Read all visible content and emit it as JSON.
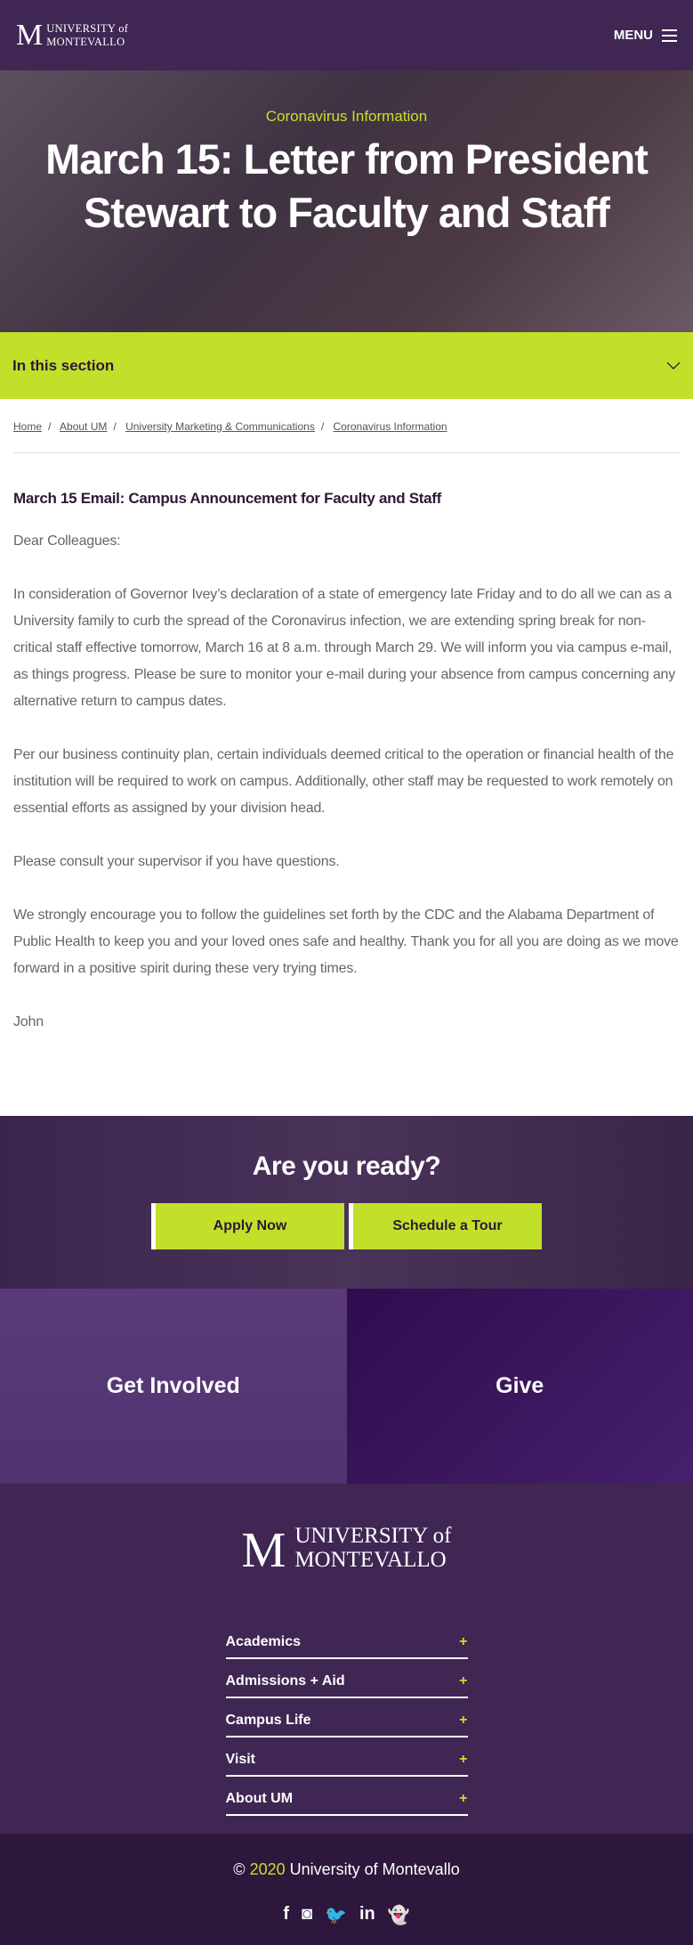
{
  "header": {
    "logo_m": "M",
    "logo_line1": "UNIVERSITY of",
    "logo_line2": "MONTEVALLO",
    "menu_label": "MENU"
  },
  "hero": {
    "subtitle": "Coronavirus Information",
    "title": "March 15: Letter from President Stewart to Faculty and Staff"
  },
  "section_nav": {
    "label": "In this section"
  },
  "breadcrumbs": [
    "Home",
    "About UM",
    "University Marketing & Communications",
    "Coronavirus Information"
  ],
  "article": {
    "heading": "March 15 Email: Campus Announcement for Faculty and Staff",
    "paragraphs": [
      "Dear Colleagues:",
      "In consideration of Governor Ivey’s declaration of a state of emergency late Friday and to do all we can as a University family to curb the spread of the Coronavirus infection, we are extending spring break for non-critical staff effective tomorrow, March 16 at 8 a.m. through March 29. We will inform you via campus e-mail, as things progress. Please be sure to monitor your e-mail during your absence from campus concerning any alternative return to campus dates.",
      "Per our business continuity plan, certain individuals deemed critical to the operation or financial health of the institution will be required to work on campus. Additionally, other staff may be requested to work remotely on essential efforts as assigned by your division head.",
      "Please consult your supervisor if you have questions.",
      "We strongly encourage you to follow the guidelines set forth by the CDC and the Alabama Department of Public Health to keep you and your loved ones safe and healthy. Thank you for all you are doing as we move forward in a positive spirit during these very trying times.",
      "John"
    ]
  },
  "cta": {
    "title": "Are you ready?",
    "apply": "Apply Now",
    "tour": "Schedule a Tour"
  },
  "tiles": [
    "Get Involved",
    "Give"
  ],
  "footer": {
    "logo_m": "M",
    "logo_line1": "UNIVERSITY of",
    "logo_line2": "MONTEVALLO",
    "nav": [
      "Academics",
      "Admissions + Aid",
      "Campus Life",
      "Visit",
      "About UM"
    ],
    "plus": "+",
    "copyright_symbol": "©",
    "year": "2020",
    "org": "University of Montevallo",
    "social": [
      "f",
      "◙",
      "🐦",
      "in",
      "👻"
    ]
  },
  "colors": {
    "purple": "#3f2653",
    "accent": "#c2e02a"
  }
}
